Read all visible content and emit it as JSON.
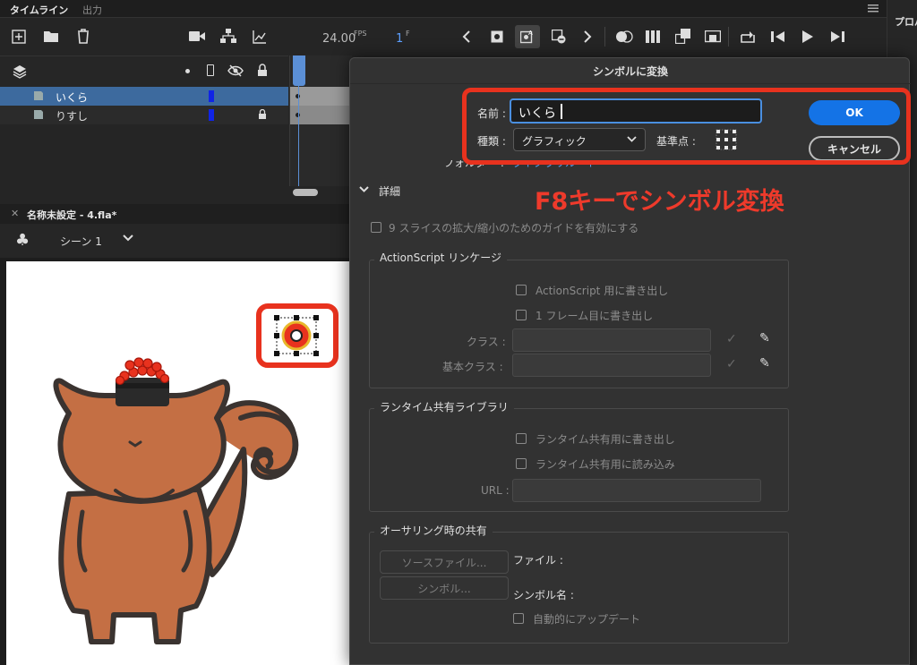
{
  "timeline": {
    "tabs": [
      "タイムライン",
      "出力"
    ],
    "fps": "24.00",
    "fps_unit": "FPS",
    "frame": "1",
    "frame_unit": "F",
    "layers": [
      {
        "name": "いくら"
      },
      {
        "name": "りすし"
      }
    ]
  },
  "document": {
    "tab_title": "名称未設定 - 4.fla*",
    "scene": "シーン 1"
  },
  "right_panel": {
    "title": "プロパ"
  },
  "dialog": {
    "title": "シンボルに変換",
    "name_label": "名前 :",
    "name_value": "いくら",
    "type_label": "種類 :",
    "type_value": "グラフィック",
    "reg_label": "基準点 :",
    "folder_label": "フォルダー :",
    "folder_value": "ライブラリルート",
    "ok": "OK",
    "cancel": "キャンセル",
    "details": "詳細",
    "nine_slice": "9 スライスの拡大/縮小のためのガイドを有効にする",
    "as_section": "ActionScript リンケージ",
    "as_export": "ActionScript 用に書き出し",
    "first_frame": "1 フレーム目に書き出し",
    "class_label": "クラス :",
    "base_class_label": "基本クラス :",
    "runtime_section": "ランタイム共有ライブラリ",
    "runtime_export": "ランタイム共有用に書き出し",
    "runtime_import": "ランタイム共有用に読み込み",
    "url_label": "URL :",
    "authoring_section": "オーサリング時の共有",
    "source_file_btn": "ソースファイル...",
    "symbol_btn": "シンボル...",
    "file_label": "ファイル :",
    "symbol_name_label": "シンボル名 :",
    "auto_update": "自動的にアップデート"
  },
  "annotation": {
    "text": "F8キーでシンボル変換",
    "color": "#ee3a2b"
  },
  "colors": {
    "accent": "#1473e6",
    "highlight_red": "#e8321e",
    "layer_selected": "#3d6a9e",
    "squirrel": "#c46f44"
  }
}
